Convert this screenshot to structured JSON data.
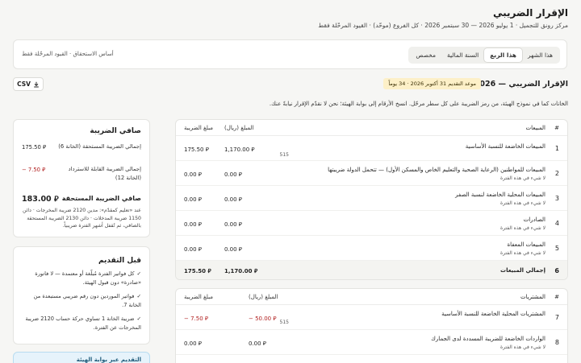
{
  "page": {
    "title": "الإقرار الضريبي",
    "subtitle": "مركز رونق للتجميل · 1 يوليو 2026 — 30 سبتمبر 2026 · كل الفروع (موحّد) · القيود المرحّلة فقط"
  },
  "filters": {
    "periods": [
      "هذا الشهر",
      "هذا الربع",
      "السنة المالية",
      "مخصص"
    ],
    "active_period": "هذا الربع",
    "basis_note": "أساس الاستحقاق · القيود المرحّلة فقط"
  },
  "toolbar": {
    "csv_label": "CSV"
  },
  "return": {
    "title": "الإقرار الضريبي — Q3 2026",
    "deadline": "موعد التقديم 31 أكتوبر 2026 · 34 يوماً",
    "instructions": "الخانات كما في نموذج الهيئة، من رمز الضريبة على كل سطر مرحّل. انسخ الأرقام إلى بوابة الهيئة؛ نحن لا نقدّم الإقرار نيابةً عنك."
  },
  "sales_table": {
    "headers": {
      "num": "#",
      "desc": "المبيعات",
      "amount": "المبلغ (ريال)",
      "tax": "مبلغ الضريبة"
    },
    "rows": [
      {
        "num": "1",
        "desc": "المبيعات الخاضعة للنسبة الأساسية",
        "sub": "515",
        "amount": "1,170.00 ⃁",
        "tax": "175.50 ⃁"
      },
      {
        "num": "2",
        "desc": "المبيعات للمواطنين (الرعاية الصحية والتعليم الخاص والمسكن الأول) — تتحمل الدولة ضريبتها",
        "sub": "لا شيء في هذه الفترة",
        "amount": "0.00 ⃁",
        "tax": "0.00 ⃁"
      },
      {
        "num": "3",
        "desc": "المبيعات المحلية الخاضعة لنسبة الصفر",
        "sub": "لا شيء في هذه الفترة",
        "amount": "0.00 ⃁",
        "tax": "0.00 ⃁"
      },
      {
        "num": "4",
        "desc": "الصادرات",
        "sub": "لا شيء في هذه الفترة",
        "amount": "0.00 ⃁",
        "tax": "0.00 ⃁"
      },
      {
        "num": "5",
        "desc": "المبيعات المعفاة",
        "sub": "لا شيء في هذه الفترة",
        "amount": "0.00 ⃁",
        "tax": "0.00 ⃁"
      }
    ],
    "total": {
      "num": "6",
      "desc": "إجمالي المبيعات",
      "amount": "1,170.00 ⃁",
      "tax": "175.50 ⃁"
    }
  },
  "purchases_table": {
    "headers": {
      "num": "#",
      "desc": "المشتريات",
      "amount": "المبلغ (ريال)",
      "tax": "مبلغ الضريبة"
    },
    "rows": [
      {
        "num": "7",
        "desc": "المشتريات المحلية الخاضعة للنسبة الأساسية",
        "sub": "515",
        "amount": "− 50.00 ⃁",
        "tax": "− 7.50 ⃁"
      },
      {
        "num": "8",
        "desc": "الواردات الخاضعة للضريبة المسددة لدى الجمارك",
        "sub": "لا شيء في هذه الفترة",
        "amount": "0.00 ⃁",
        "tax": "0.00 ⃁"
      }
    ]
  },
  "net_tax": {
    "title": "صافي الضريبة",
    "output_label": "إجمالي الضريبة المستحقة (الخانة 6)",
    "output_value": "175.50 ⃁",
    "input_label": "إجمالي الضريبة القابلة للاسترداد (الخانة 12)",
    "input_value": "− 7.50 ⃁",
    "net_label": "صافي الضريبة المستحقة",
    "net_value": "183.00 ⃁",
    "note": "عند «تعليم كمقدّم»: مدين 2120 ضريبة المخرجات · دائن 1150 ضريبة المدخلات · دائن 2130 الضريبة المستحقة بالصافي، ثم تُقفل أشهر الفترة ضريبياً."
  },
  "before_filing": {
    "title": "قبل التقديم",
    "items": [
      "كل فواتير الفترة مُبلّغة أو معتمدة — لا فاتورة «صادرة» دون قبول الهيئة.",
      "فواتير الموردين دون رقم ضريبي مستبعدة من الخانة 7.",
      "ضريبة الخانة 1 تساوي حركة حساب 2120 ضريبة المخرجات عن الفترة."
    ]
  },
  "portal": {
    "label": "التقديم عبر بوابة الهيئة"
  },
  "colors": {
    "accent_badge": "#fdf0c8",
    "negative": "#b01e1e",
    "portal_bg": "#e6f3fb"
  }
}
